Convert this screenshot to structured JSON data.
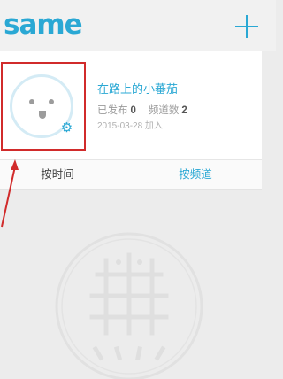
{
  "header": {
    "logo_text": "same",
    "add_icon": "plus-icon"
  },
  "profile": {
    "username": "在路上的小蕃茄",
    "published_label": "已发布",
    "published_count": "0",
    "channels_label": "频道数",
    "channels_count": "2",
    "joined_text": "2015-03-28 加入",
    "avatar_icon": "smiley-face-icon",
    "settings_icon": "gear-icon"
  },
  "tabs": {
    "by_time": "按时间",
    "by_channel": "按频道"
  },
  "colors": {
    "accent": "#2aa8d4",
    "highlight": "#d12b2b"
  }
}
